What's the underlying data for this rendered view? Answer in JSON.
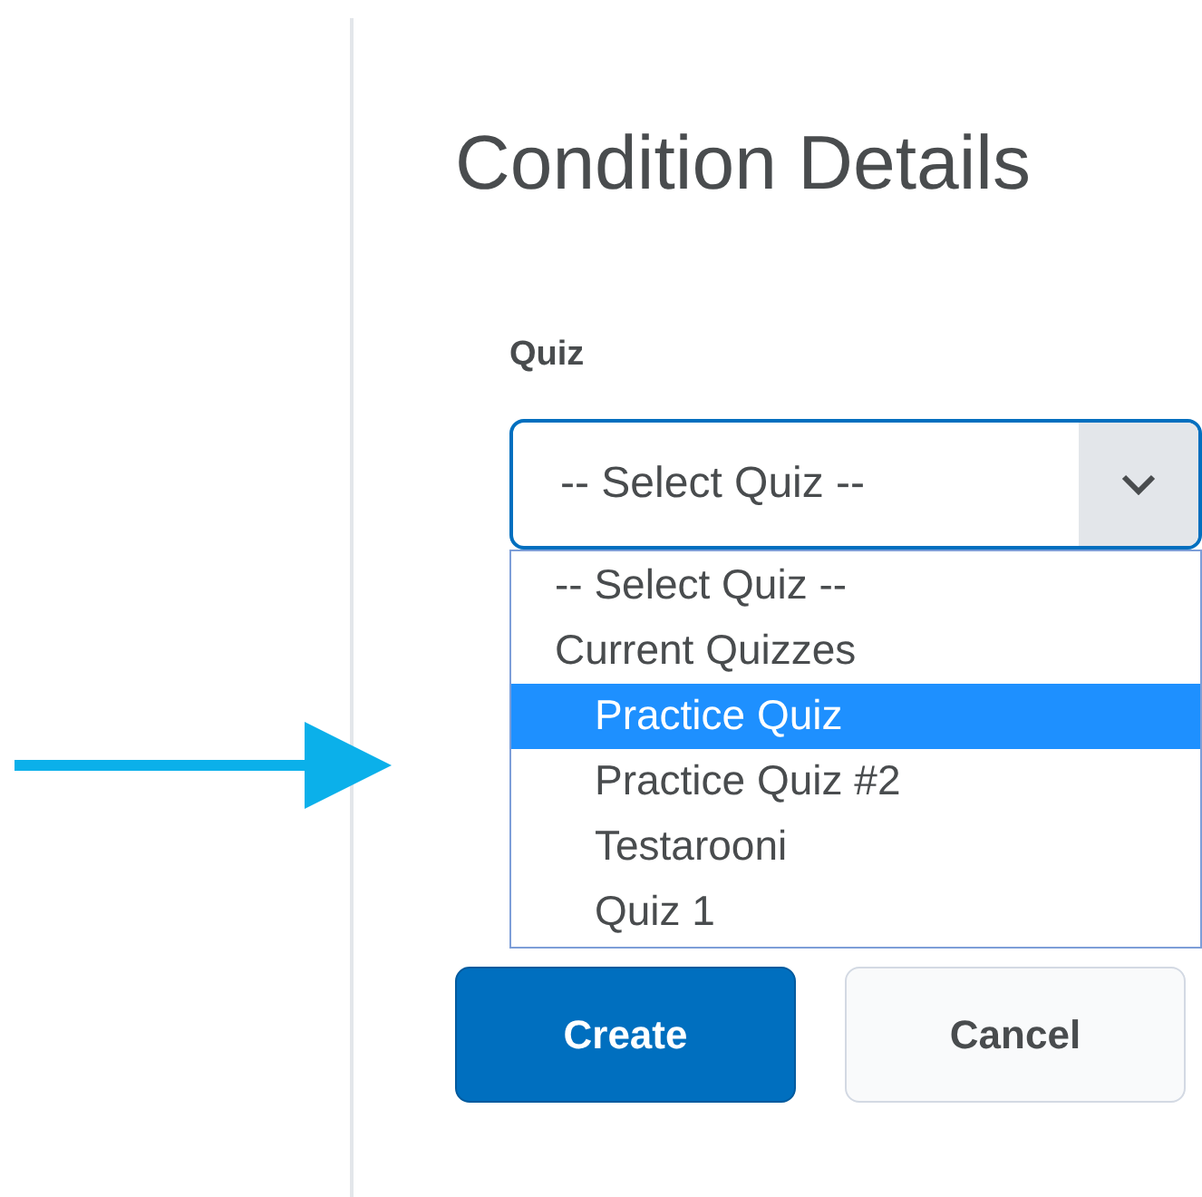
{
  "title": "Condition Details",
  "field_label": "Quiz",
  "select": {
    "value": "-- Select Quiz --",
    "expanded": true
  },
  "options": [
    {
      "label": "-- Select Quiz --",
      "kind": "placeholder",
      "selected": false
    },
    {
      "label": "Current Quizzes",
      "kind": "group",
      "selected": false
    },
    {
      "label": "Practice Quiz",
      "kind": "option",
      "selected": true
    },
    {
      "label": "Practice Quiz #2",
      "kind": "option",
      "selected": false
    },
    {
      "label": "Testarooni",
      "kind": "option",
      "selected": false
    },
    {
      "label": "Quiz 1",
      "kind": "option",
      "selected": false
    }
  ],
  "buttons": [
    {
      "label": "Create",
      "kind": "primary"
    },
    {
      "label": "Cancel",
      "kind": "secondary"
    }
  ]
}
